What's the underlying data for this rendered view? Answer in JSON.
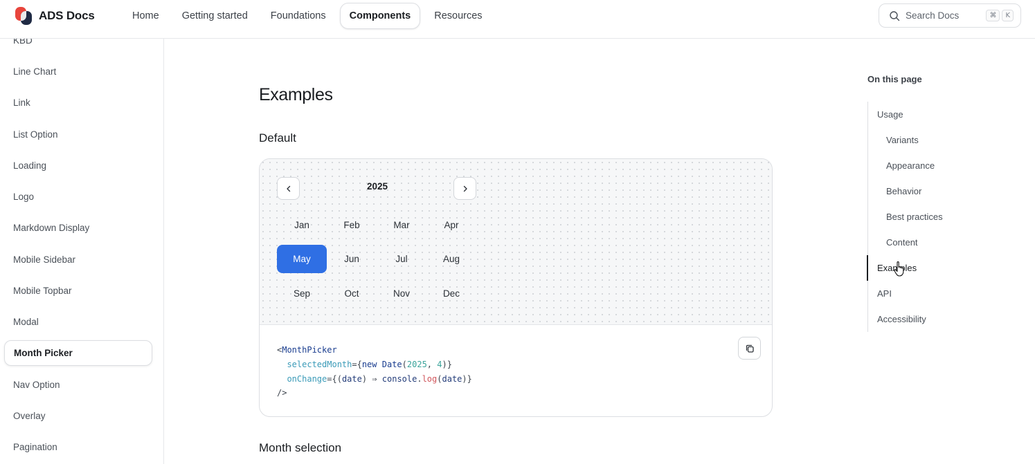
{
  "brand": {
    "name": "ADS Docs"
  },
  "nav": {
    "items": [
      {
        "label": "Home",
        "active": false
      },
      {
        "label": "Getting started",
        "active": false
      },
      {
        "label": "Foundations",
        "active": false
      },
      {
        "label": "Components",
        "active": true
      },
      {
        "label": "Resources",
        "active": false
      }
    ]
  },
  "search": {
    "placeholder": "Search Docs",
    "shortcut_mod": "⌘",
    "shortcut_key": "K"
  },
  "sidebar": {
    "items": [
      {
        "label": "KBD"
      },
      {
        "label": "Line Chart"
      },
      {
        "label": "Link"
      },
      {
        "label": "List Option"
      },
      {
        "label": "Loading"
      },
      {
        "label": "Logo"
      },
      {
        "label": "Markdown Display"
      },
      {
        "label": "Mobile Sidebar"
      },
      {
        "label": "Mobile Topbar"
      },
      {
        "label": "Modal"
      },
      {
        "label": "Month Picker",
        "active": true
      },
      {
        "label": "Nav Option"
      },
      {
        "label": "Overlay"
      },
      {
        "label": "Pagination"
      }
    ]
  },
  "main": {
    "heading": "Examples",
    "default_heading": "Default",
    "month_selection_heading": "Month selection",
    "picker": {
      "year": "2025",
      "selected": "May",
      "months": [
        "Jan",
        "Feb",
        "Mar",
        "Apr",
        "May",
        "Jun",
        "Jul",
        "Aug",
        "Sep",
        "Oct",
        "Nov",
        "Dec"
      ]
    },
    "code": {
      "tag_open": "<",
      "component": "MonthPicker",
      "attr1": "selectedMonth",
      "attr2": "onChange",
      "new_kw": "new",
      "date_ctor": "Date",
      "year_arg": "2025",
      "month_arg": "4",
      "param": "date",
      "arrow": "⇒",
      "console": "console",
      "log": "log",
      "tag_close": "/>"
    }
  },
  "toc": {
    "title": "On this page",
    "items": [
      {
        "label": "Usage",
        "indent": false
      },
      {
        "label": "Variants",
        "indent": true
      },
      {
        "label": "Appearance",
        "indent": true
      },
      {
        "label": "Behavior",
        "indent": true
      },
      {
        "label": "Best practices",
        "indent": true
      },
      {
        "label": "Content",
        "indent": true
      },
      {
        "label": "Examples",
        "indent": false,
        "active": true
      },
      {
        "label": "API",
        "indent": false
      },
      {
        "label": "Accessibility",
        "indent": false
      }
    ]
  },
  "colors": {
    "accent": "#2f6fe4",
    "brand_red": "#e8453c",
    "brand_dark": "#1f2a44"
  }
}
